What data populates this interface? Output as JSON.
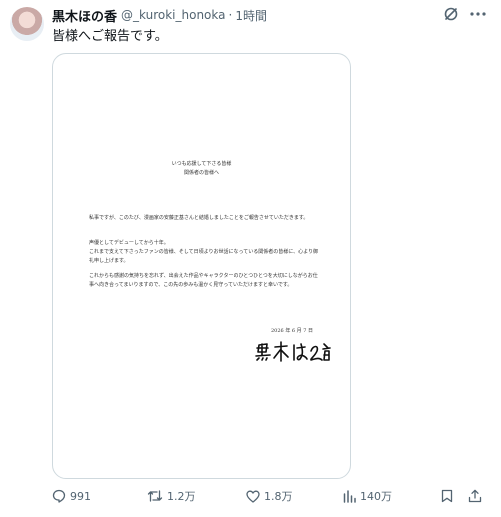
{
  "post": {
    "display_name": "黒木ほの香",
    "handle": "@_kuroki_honoka",
    "separator": "·",
    "time": "1時間",
    "text": "皆様へご報告です。",
    "icons": {
      "grok": "grok-icon",
      "more": "more-horizontal-icon"
    }
  },
  "letter": {
    "heading_line1": "いつも応援して下さる皆様",
    "heading_line2": "関係者の皆様へ",
    "paragraph1": "私事ですが、このたび、漫画家の安藤正基さんと結婚しましたことをご報告させていただきます。",
    "paragraph2_line1": "声優としてデビューしてから十年。",
    "paragraph2_line2": "これまで支えて下さったファンの皆様、そして日頃よりお世話になっている関係者の皆様に、心より御礼申し上げます。",
    "paragraph3": "これからも感謝の気持ちを忘れず、出会えた作品やキャラクターのひとつひとつを大切にしながらお仕事へ向き合ってまいりますので、この先の歩みも温かく見守っていただけますと幸いです。",
    "date": "2026 年 6 月 7 日",
    "signature": "黒木ほの香"
  },
  "actions": {
    "replies": "991",
    "reposts": "1.2万",
    "likes": "1.8万",
    "views": "140万",
    "icons": [
      "reply-icon",
      "repost-icon",
      "like-icon",
      "views-icon",
      "bookmark-icon",
      "share-icon"
    ]
  }
}
